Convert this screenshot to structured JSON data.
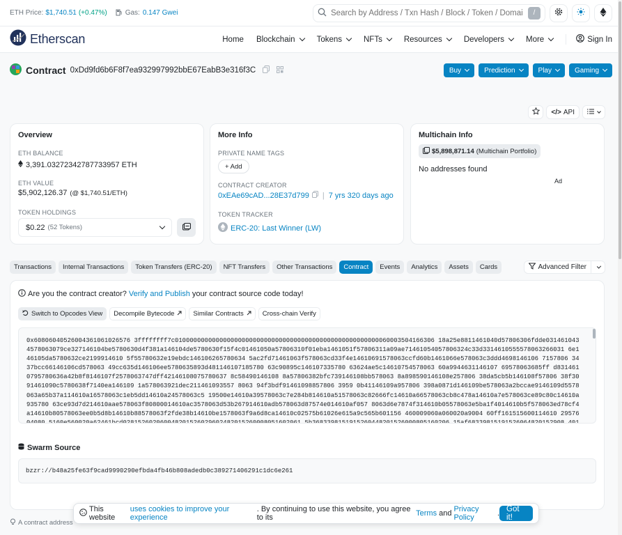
{
  "topbar": {
    "eth_price_label": "ETH Price:",
    "eth_price_value": "$1,740.51",
    "eth_price_change": "(+0.47%)",
    "gas_label": "Gas:",
    "gas_value": "0.147 Gwei",
    "search_placeholder": "Search by Address / Txn Hash / Block / Token / Domai",
    "search_shortcut": "/"
  },
  "nav": {
    "logo_text": "Etherscan",
    "items": [
      "Home",
      "Blockchain",
      "Tokens",
      "NFTs",
      "Resources",
      "Developers",
      "More"
    ],
    "signin": "Sign In"
  },
  "contract": {
    "title": "Contract",
    "address": "0xDd9fd6b6F8f7ea932997992bbE67EabB3e316f3C",
    "buttons": [
      "Buy",
      "Prediction",
      "Play",
      "Gaming"
    ]
  },
  "tools": {
    "api": "API"
  },
  "overview": {
    "title": "Overview",
    "eth_balance_label": "ETH BALANCE",
    "eth_balance": "3,391.03272342787733957 ETH",
    "eth_value_label": "ETH VALUE",
    "eth_value": "$5,902,126.37",
    "eth_value_rate": "(@ $1,740.51/ETH)",
    "token_holdings_label": "TOKEN HOLDINGS",
    "token_holdings_value": "$0.22",
    "token_holdings_count": "(52 Tokens)"
  },
  "more_info": {
    "title": "More Info",
    "private_tags_label": "PRIVATE NAME TAGS",
    "add_button": "+ Add",
    "creator_label": "CONTRACT CREATOR",
    "creator_address": "0xEAe69cAD...28E37d799",
    "creator_age": "7 yrs 320 days ago",
    "tracker_label": "TOKEN TRACKER",
    "tracker_value": "ERC-20: Last Winner (LW)"
  },
  "multichain": {
    "title": "Multichain Info",
    "portfolio_value": "$5,898,871.14",
    "portfolio_label": "(Multichain Portfolio)",
    "no_addresses": "No addresses found",
    "ad": "Ad"
  },
  "tabs": [
    "Transactions",
    "Internal Transactions",
    "Token Transfers (ERC-20)",
    "NFT Transfers",
    "Other Transactions",
    "Contract",
    "Events",
    "Analytics",
    "Assets",
    "Cards"
  ],
  "active_tab": "Contract",
  "advanced_filter": "Advanced Filter",
  "contract_panel": {
    "question": "Are you the contract creator?",
    "verify_link": "Verify and Publish",
    "question_tail": "your contract source code today!",
    "sub_buttons": [
      "Switch to Opcodes View",
      "Decompile Bytecode",
      "Similar Contracts",
      "Cross-chain Verify"
    ],
    "bytecode": "0x60806040526004361061026576 3ffffffff7c0100000000000000000000000000000000000000000000000000000060003504166306 18a25e8811461040d57806306fdde0314610434578063079ce327146104be5780630d4f381a146104de5780630f15f4c01461050a57806310f01eba1461051f57806311a09ae71461054057806324c33d3314610555578063266031 6e146105da5780632ce2199914610 5f55780632e19ebdc146106265780634 5ac2fd71461063f578063cd33f4e14610691578063ccfd60b1461066e578063c3ddd4698146106 7157806 3437bcc66146106cd578063 49cc635d146106ee5780635893d481146107185780 63c90895c146107335780 63624ae5c14610754578063 60a9944631146107 69578063685ff d8314610795780636a42b8f8146107f2578063747dff42146108075780637 8c58490146108 8a57806382bfc739146108bb578063 8a898590146108e257806 38da5cb5b146108f57806 38f3091461090c5780638f7140ea146109 1a578063921dec211461093557 8063 94f3bdf91461098857806 3959 0b41146109a957806 398a0871d146109be578063a2bccae9146109d5578063a65b37a114610a16578063c1eb5dd14610a24578063c5 19500e14610a39578063c7e284b814610a51578063c82666fc14610a66578063cb8c478a14610a7e578063ce89c80c14610a935780 63ce93d7d214610aae578063f80800014610ac3578063d53b267914610adb578063d87574e014610af057 8063d6e7874f314610b05578063e5ba1f4014610b5f578063ed78cf4a14610b80578063ee0b5d8b14610b88578063f2fde38b14610be1578063f9a6d8ca14610c02575b61026e615a9c565b601156 460009060a060020a9004 60ff161515600114610 2957604080 5160e560020a62461bcd028152602060048201526029602482015260008051602061 5b3683398151915260448201526000805160206 15af68339815191526064820152908 4019003 608401 90fd5b33803b80156103205760408051 60e560020a62461bcd0281"
  },
  "swarm": {
    "title": "Swarm Source",
    "value": "bzzr://b48a25fe63f9cad9990290efbda4fb46b808adedb0c389271406291c1dc6e261"
  },
  "cookie": {
    "text_a": "This website",
    "link_a": "uses cookies to improve your experience",
    "text_b": ". By continuing to use this website, you agree to its",
    "link_terms": "Terms",
    "text_and": "and",
    "link_privacy": "Privacy Policy",
    "button": "Got it!"
  },
  "footer_note": "A contract address"
}
